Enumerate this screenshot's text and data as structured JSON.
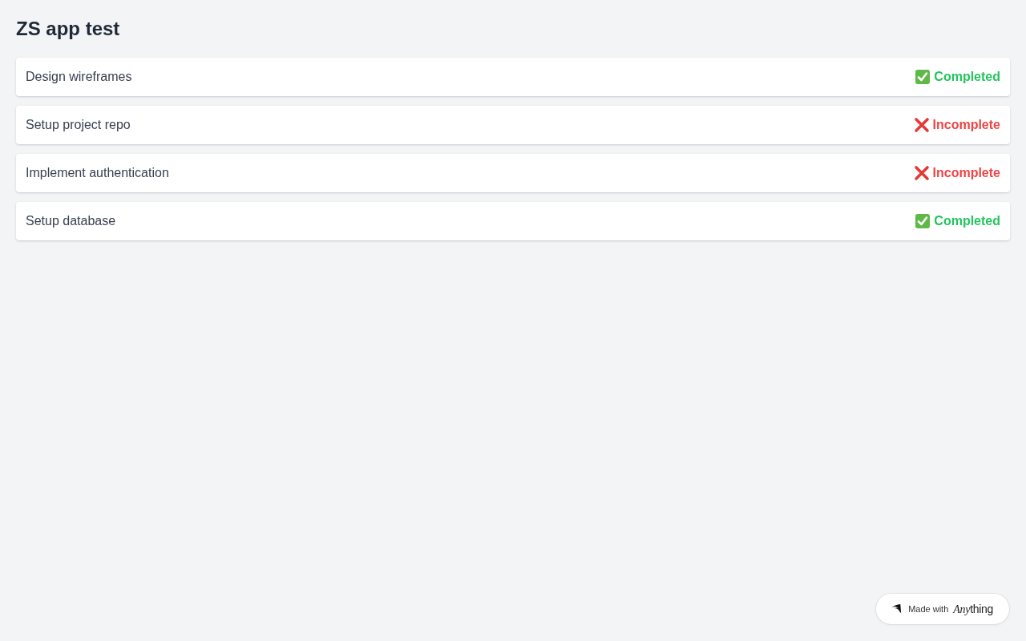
{
  "title": "ZS app test",
  "tasks": [
    {
      "name": "Design wireframes",
      "status": "Completed",
      "done": true
    },
    {
      "name": "Setup project repo",
      "status": "Incomplete",
      "done": false
    },
    {
      "name": "Implement authentication",
      "status": "Incomplete",
      "done": false
    },
    {
      "name": "Setup database",
      "status": "Completed",
      "done": true
    }
  ],
  "badge": {
    "label": "Made with",
    "brand_script": "Any",
    "brand_rest": "thing"
  }
}
